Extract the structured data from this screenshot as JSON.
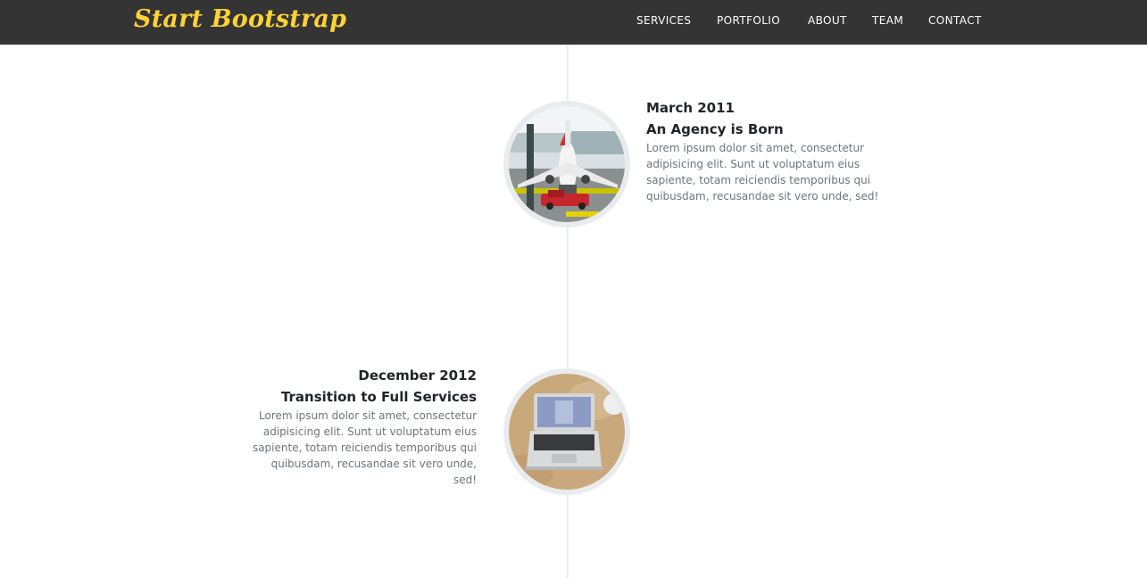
{
  "navbar": {
    "brand": "Start Bootstrap",
    "links": [
      "SERVICES",
      "PORTFOLIO",
      "ABOUT",
      "TEAM",
      "CONTACT"
    ]
  },
  "timeline": [
    {
      "date": "March 2011",
      "title": "An Agency is Born",
      "body": "Lorem ipsum dolor sit amet, consectetur adipisicing elit. Sunt ut voluptatum eius sapiente, totam reiciendis temporibus qui quibusdam, recusandae sit vero unde, sed!",
      "image": "airplane-photo"
    },
    {
      "date": "December 2012",
      "title": "Transition to Full Services",
      "body": "Lorem ipsum dolor sit amet, consectetur adipisicing elit. Sunt ut voluptatum eius sapiente, totam reiciendis temporibus qui quibusdam, recusandae sit vero unde, sed!",
      "image": "laptop-photo"
    }
  ],
  "colors": {
    "navbar_bg": "#343434",
    "brand": "#fed136",
    "nav_text": "#ffffff",
    "heading": "#212529",
    "muted": "#6c757d",
    "timeline": "#e9ecef"
  }
}
